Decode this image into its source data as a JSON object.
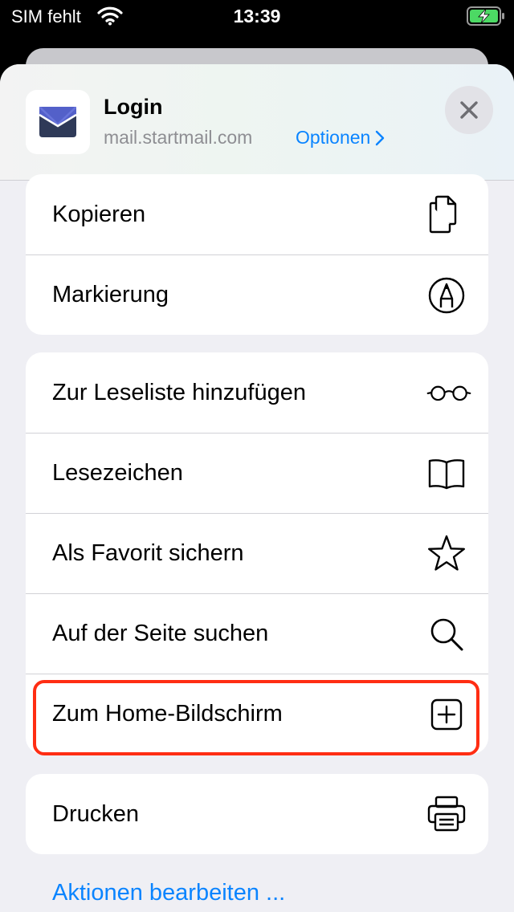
{
  "status_bar": {
    "carrier": "SIM fehlt",
    "time": "13:39"
  },
  "header": {
    "title": "Login",
    "url": "mail.startmail.com",
    "options_label": "Optionen"
  },
  "groups": [
    {
      "items": [
        {
          "label": "Kopieren",
          "icon": "copy-icon"
        },
        {
          "label": "Markierung",
          "icon": "markup-icon"
        }
      ]
    },
    {
      "items": [
        {
          "label": "Zur Leseliste hinzufügen",
          "icon": "glasses-icon"
        },
        {
          "label": "Lesezeichen",
          "icon": "book-icon"
        },
        {
          "label": "Als Favorit sichern",
          "icon": "star-icon"
        },
        {
          "label": "Auf der Seite suchen",
          "icon": "search-icon"
        },
        {
          "label": "Zum Home-Bildschirm",
          "icon": "add-square-icon",
          "highlighted": true
        }
      ]
    },
    {
      "items": [
        {
          "label": "Drucken",
          "icon": "printer-icon"
        }
      ]
    }
  ],
  "footer": {
    "edit_actions_label": "Aktionen bearbeiten ..."
  },
  "colors": {
    "accent": "#0a84ff",
    "highlight": "#ff2d13",
    "battery_charging": "#4cd964",
    "mail_icon": "#2f3a58"
  }
}
